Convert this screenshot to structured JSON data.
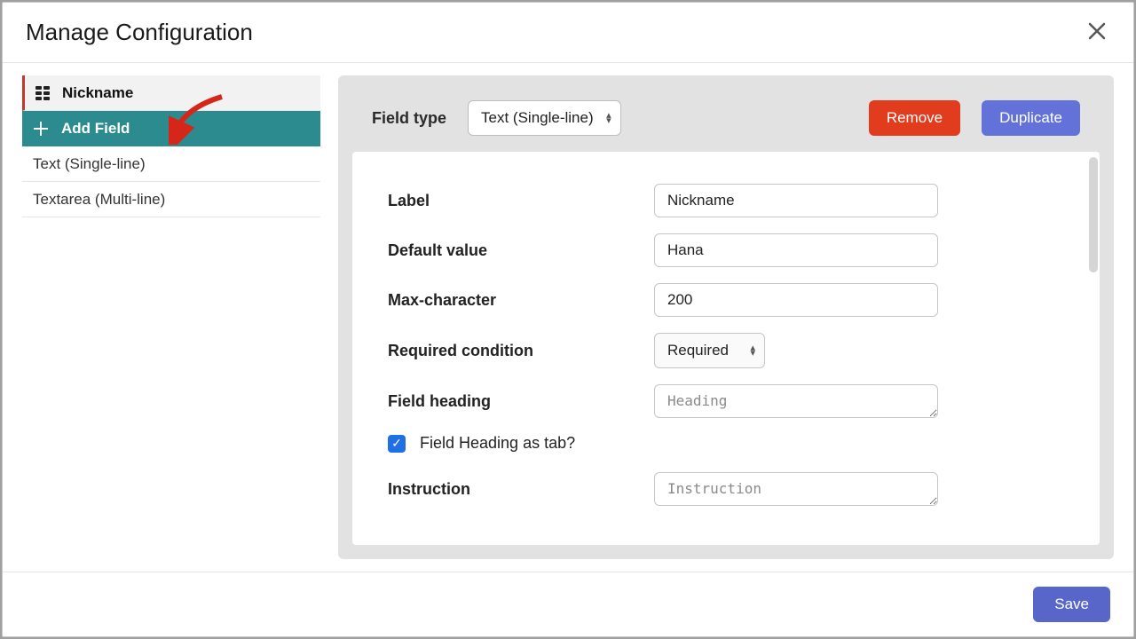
{
  "header": {
    "title": "Manage Configuration"
  },
  "sidebar": {
    "items": [
      {
        "label": "Nickname"
      },
      {
        "label": "Add Field"
      },
      {
        "label": "Text (Single-line)"
      },
      {
        "label": "Textarea (Multi-line)"
      }
    ]
  },
  "panel": {
    "field_type_label": "Field type",
    "field_type_value": "Text (Single-line)",
    "remove": "Remove",
    "duplicate": "Duplicate"
  },
  "form": {
    "label_label": "Label",
    "label_value": "Nickname",
    "default_label": "Default value",
    "default_value": "Hana",
    "max_label": "Max-character",
    "max_value": "200",
    "required_label": "Required condition",
    "required_value": "Required",
    "heading_label": "Field heading",
    "heading_placeholder": "Heading",
    "heading_as_tab": "Field Heading as tab?",
    "instruction_label": "Instruction",
    "instruction_placeholder": "Instruction"
  },
  "footer": {
    "save": "Save"
  }
}
